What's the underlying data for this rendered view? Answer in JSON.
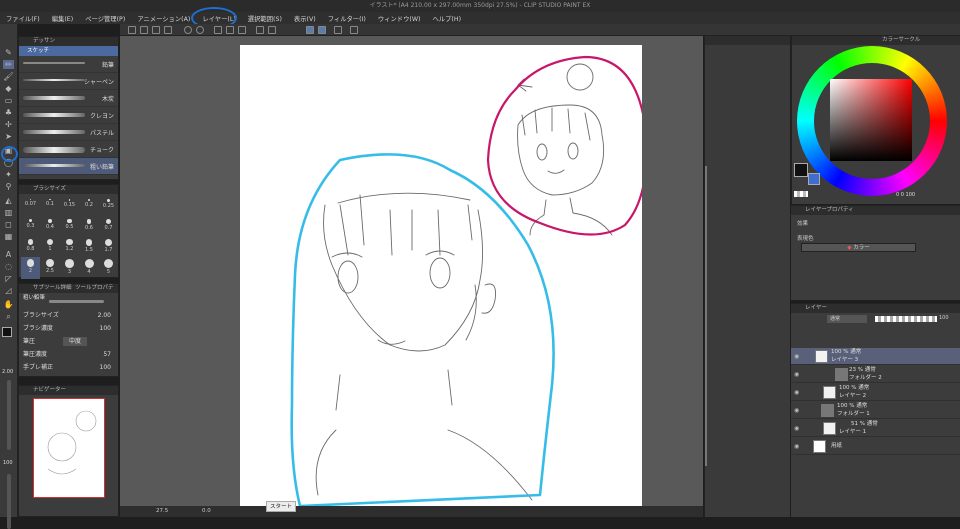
{
  "window": {
    "title": "イラスト* (A4 210.00 x 297.00mm 350dpi 27.5%) - CLIP STUDIO PAINT EX"
  },
  "menu": [
    "ファイル(F)",
    "編集(E)",
    "ページ管理(P)",
    "アニメーション(A)",
    "レイヤー(L)",
    "選択範囲(S)",
    "表示(V)",
    "フィルター(I)",
    "ウィンドウ(W)",
    "ヘルプ(H)"
  ],
  "subtool": {
    "tab": "デッサン",
    "group": "鉛筆",
    "header_sub": "スケッチ",
    "brushes": [
      "鉛筆",
      "シャーペン",
      "木炭",
      "クレヨン",
      "パステル",
      "チョーク",
      "粗い鉛筆"
    ]
  },
  "brush_size": {
    "title": "ブラシサイズ",
    "sizes": [
      "0.07",
      "0.1",
      "0.15",
      "0.2",
      "0.25",
      "0.3",
      "0.4",
      "0.5",
      "0.6",
      "0.7",
      "0.8",
      "1",
      "1.2",
      "1.5",
      "1.7",
      "2",
      "2.5",
      "3",
      "4",
      "5"
    ],
    "selected_index": 15
  },
  "tool_property": {
    "tab1": "サブツール詳細",
    "tab2": "ツールプロパティ",
    "name": "粗い鉛筆",
    "rows": [
      {
        "label": "ブラシサイズ",
        "value": "2.00"
      },
      {
        "label": "ブラシ濃度",
        "value": "100"
      },
      {
        "label": "筆圧",
        "value": "中度"
      },
      {
        "label": "筆圧濃度",
        "value": "57"
      },
      {
        "label": "手ブレ補正",
        "value": "100"
      }
    ]
  },
  "left_readouts": {
    "size": "2.00",
    "opacity": "100"
  },
  "navigator": {
    "title": "ナビゲーター"
  },
  "status": {
    "zoom": "27.5",
    "angle": "0.0",
    "start": "スタート"
  },
  "color": {
    "tab_label": "カラーサークル",
    "main_color": "#111111",
    "sub_color": "#3e6fd0",
    "hsv": "0 0 100"
  },
  "layer_property": {
    "title": "レイヤープロパティ",
    "effect_label": "効果",
    "display_color_label": "表現色",
    "display_color_value": "カラー"
  },
  "layers_panel": {
    "title": "レイヤー",
    "blend": "通常",
    "opacity": "100",
    "layers": [
      {
        "top": "100 % 通常",
        "name": "レイヤー 3",
        "selected": true
      },
      {
        "top": "23 % 通常",
        "name": "フォルダー 2",
        "selected": false
      },
      {
        "top": "100 % 通常",
        "name": "レイヤー 2",
        "selected": false
      },
      {
        "top": "100 % 通常",
        "name": "フォルダー 1",
        "selected": false
      },
      {
        "top": "51 % 通常",
        "name": "レイヤー 1",
        "selected": false
      },
      {
        "top": "",
        "name": "用紙",
        "selected": false
      }
    ]
  },
  "accents": {
    "cyan_annotation": "#35bde8",
    "magenta_annotation": "#c8166a",
    "selection_blue": "#1e6fd0"
  }
}
